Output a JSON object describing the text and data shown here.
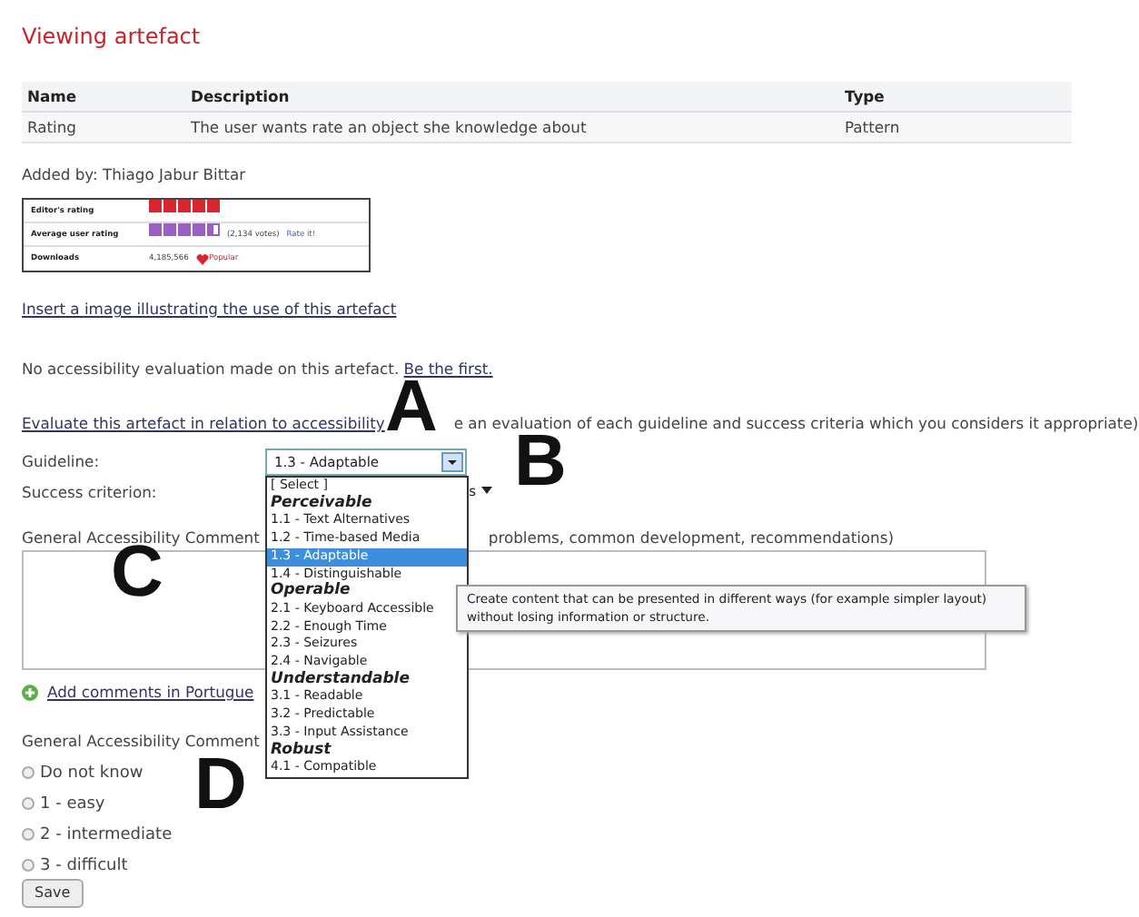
{
  "page_title": "Viewing artefact",
  "table": {
    "columns": [
      "Name",
      "Description",
      "Type"
    ],
    "rows": [
      [
        "Rating",
        "The user wants rate an object she knowledge about",
        "Pattern"
      ]
    ]
  },
  "added_by": "Added by: Thiago Jabur Bittar",
  "rating_widget": {
    "rows": [
      {
        "label": "Editor's rating",
        "kind": "stars",
        "stars": 5,
        "color": "#d9262e"
      },
      {
        "label": "Average user rating",
        "kind": "stars",
        "stars": 4.5,
        "color": "#9a5fc0",
        "votes": "(2,134 votes)",
        "link": "Rate it!"
      },
      {
        "label": "Downloads",
        "kind": "count",
        "value": "4,185,566",
        "badge": "Popular"
      }
    ]
  },
  "insert_image_link": "Insert a image illustrating the use of this artefact",
  "no_evaluation": {
    "text": "No accessibility evaluation made on this artefact.",
    "link": "Be the first."
  },
  "evaluate": {
    "link": "Evaluate this artefact in relation to accessibility",
    "rest": "e an evaluation of each guideline and success criteria which you considers it appropriate)"
  },
  "guideline": {
    "label": "Guideline:",
    "value": "1.3 - Adaptable",
    "expanded": true
  },
  "success_criterion": {
    "label": "Success criterion:",
    "value": "s"
  },
  "comment_label": {
    "start": "General Accessibility Comment",
    "end": "problems, common development, recommendations)"
  },
  "add_comments_link": "Add comments in Portugue",
  "difficulty": {
    "label": "General Accessibility Comment",
    "options": [
      {
        "label": "Do not know",
        "selected": false
      },
      {
        "label": "1 - easy",
        "selected": false
      },
      {
        "label": "2 - intermediate",
        "selected": false
      },
      {
        "label": "3 - difficult",
        "selected": false
      }
    ]
  },
  "save_button": "Save",
  "dropdown": [
    {
      "kind": "option",
      "label": "[ Select ]",
      "selected": false
    },
    {
      "kind": "group",
      "label": "Perceivable"
    },
    {
      "kind": "option",
      "label": "1.1 - Text Alternatives",
      "selected": false
    },
    {
      "kind": "option",
      "label": "1.2 - Time-based Media",
      "selected": false
    },
    {
      "kind": "option",
      "label": "1.3 - Adaptable",
      "selected": true
    },
    {
      "kind": "option",
      "label": "1.4 - Distinguishable",
      "selected": false
    },
    {
      "kind": "group",
      "label": "Operable"
    },
    {
      "kind": "option",
      "label": "2.1 - Keyboard Accessible",
      "selected": false
    },
    {
      "kind": "option",
      "label": "2.2 - Enough Time",
      "selected": false
    },
    {
      "kind": "option",
      "label": "2.3 - Seizures",
      "selected": false
    },
    {
      "kind": "option",
      "label": "2.4 - Navigable",
      "selected": false
    },
    {
      "kind": "group",
      "label": "Understandable"
    },
    {
      "kind": "option",
      "label": "3.1 - Readable",
      "selected": false
    },
    {
      "kind": "option",
      "label": "3.2 - Predictable",
      "selected": false
    },
    {
      "kind": "option",
      "label": "3.3 - Input Assistance",
      "selected": false
    },
    {
      "kind": "group",
      "label": "Robust"
    },
    {
      "kind": "option",
      "label": "4.1 - Compatible",
      "selected": false
    }
  ],
  "tooltip": "Create content that can be presented in different ways (for example simpler layout) without losing information or structure.",
  "annotations": [
    {
      "label": "A"
    },
    {
      "label": "B"
    },
    {
      "label": "C"
    },
    {
      "label": "D"
    }
  ]
}
